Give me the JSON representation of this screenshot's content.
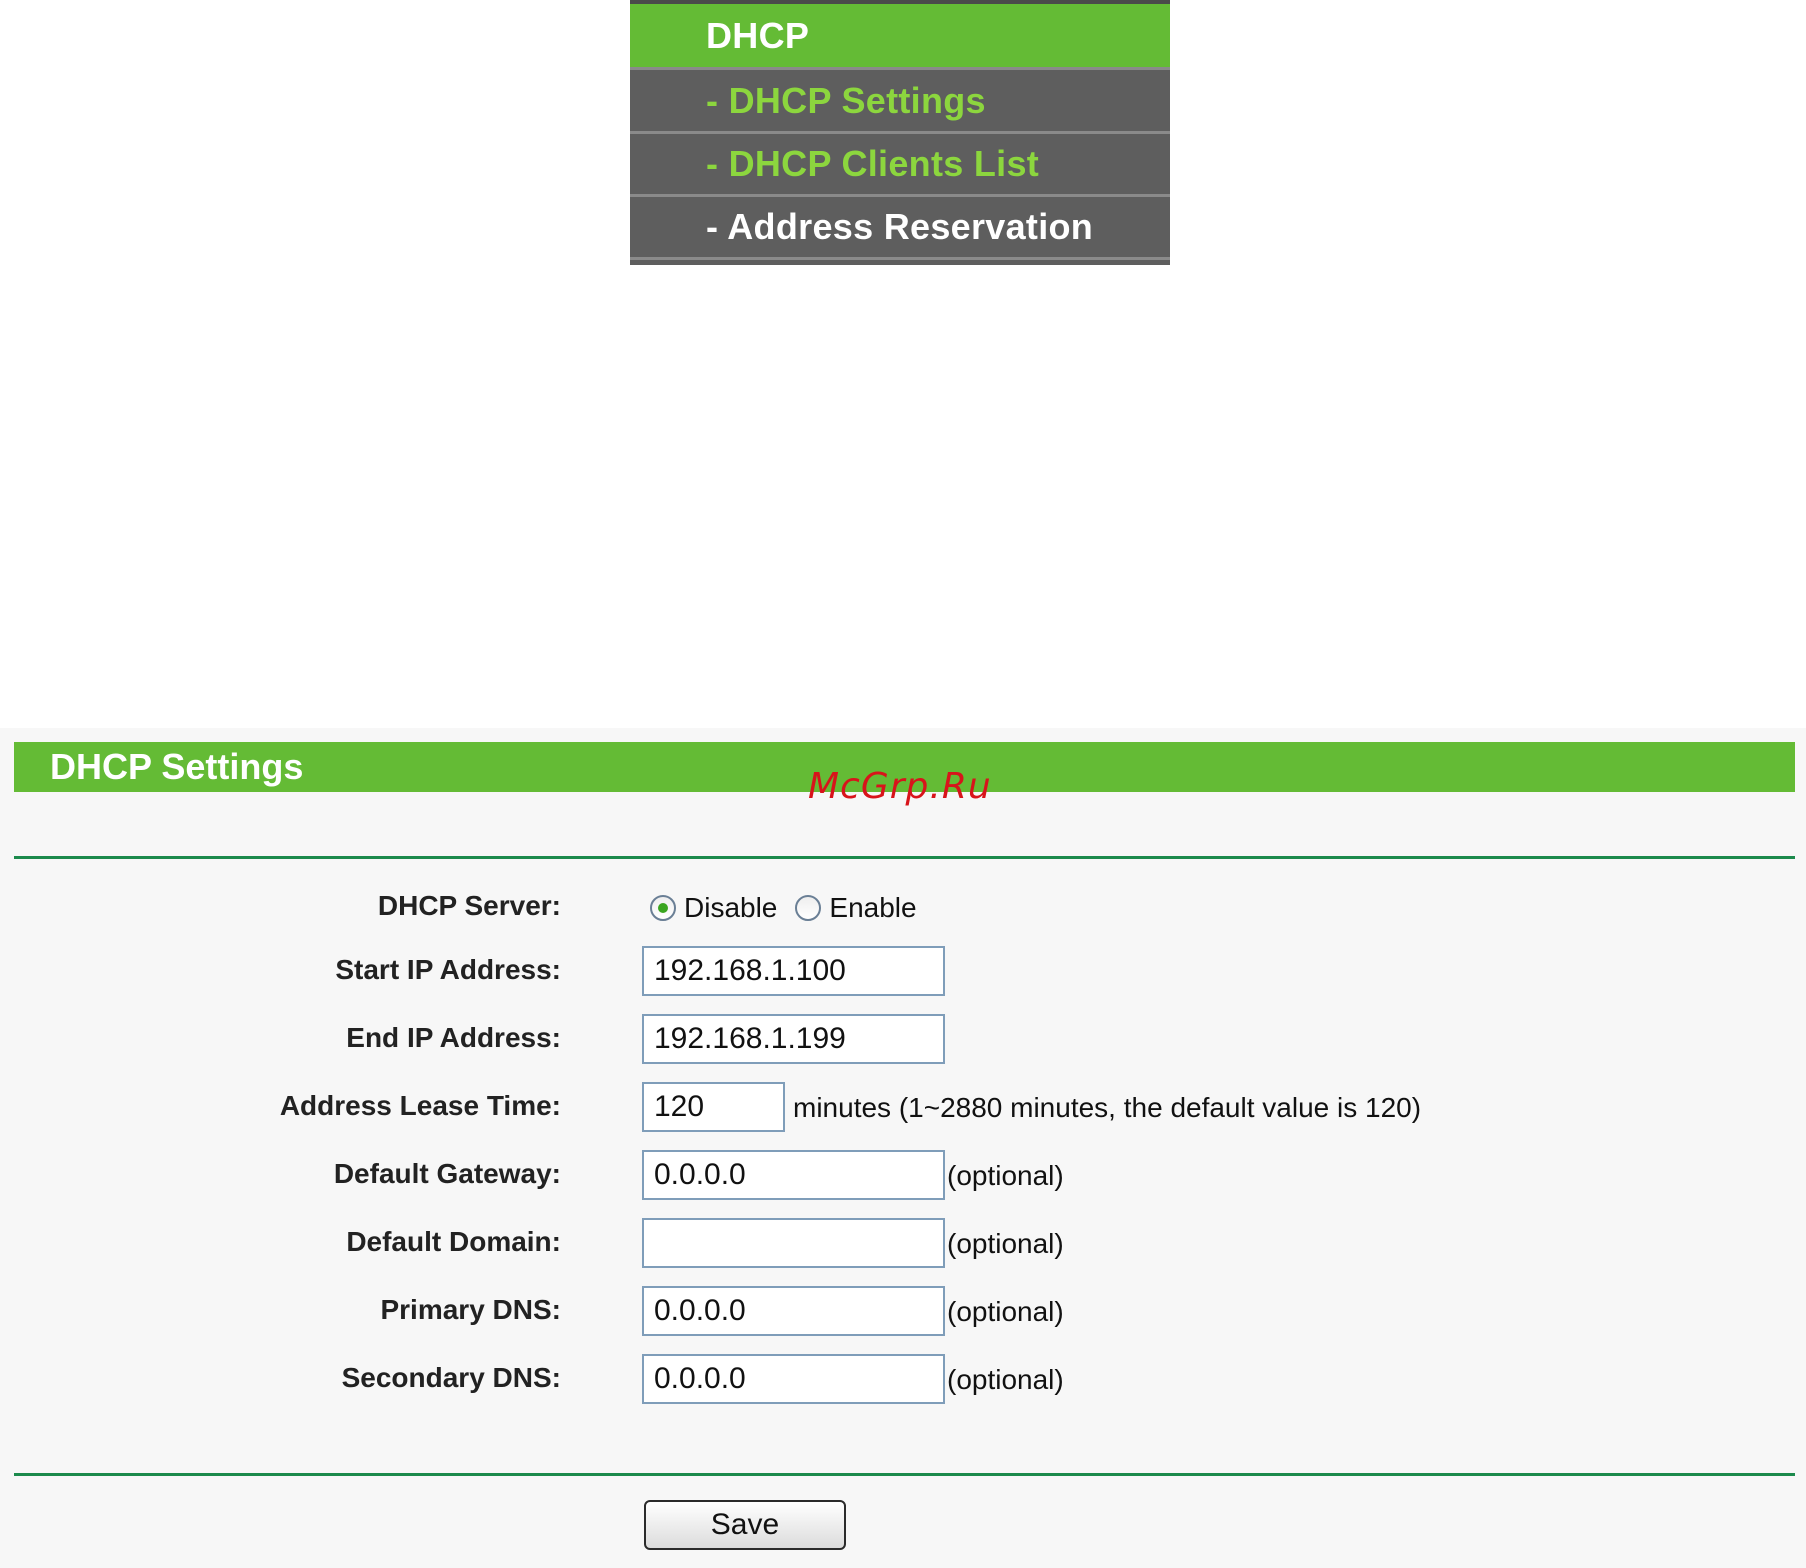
{
  "menu": {
    "header": "DHCP",
    "items": [
      {
        "label": "- DHCP Settings"
      },
      {
        "label": "- DHCP Clients List"
      },
      {
        "label": "- Address Reservation"
      }
    ]
  },
  "panel": {
    "title": "DHCP Settings",
    "watermark": "McGrp.Ru"
  },
  "form": {
    "dhcp_server": {
      "label": "DHCP Server:",
      "options": [
        "Disable",
        "Enable"
      ],
      "selected": "Disable"
    },
    "start_ip": {
      "label": "Start IP Address:",
      "value": "192.168.1.100"
    },
    "end_ip": {
      "label": "End IP Address:",
      "value": "192.168.1.199"
    },
    "lease_time": {
      "label": "Address Lease Time:",
      "value": "120",
      "note": "minutes (1~2880 minutes, the default value is 120)"
    },
    "gateway": {
      "label": "Default Gateway:",
      "value": "0.0.0.0",
      "note": "(optional)"
    },
    "domain": {
      "label": "Default Domain:",
      "value": "",
      "note": "(optional)"
    },
    "primary_dns": {
      "label": "Primary DNS:",
      "value": "0.0.0.0",
      "note": "(optional)"
    },
    "secondary_dns": {
      "label": "Secondary DNS:",
      "value": "0.0.0.0",
      "note": "(optional)"
    }
  },
  "actions": {
    "save_label": "Save"
  },
  "colors": {
    "accent_green": "#64bb35",
    "menu_gray": "#5e5e5e",
    "menu_link_green": "#8cd63e",
    "rule_green": "#1c8a4c",
    "watermark_red": "#d8141b"
  }
}
